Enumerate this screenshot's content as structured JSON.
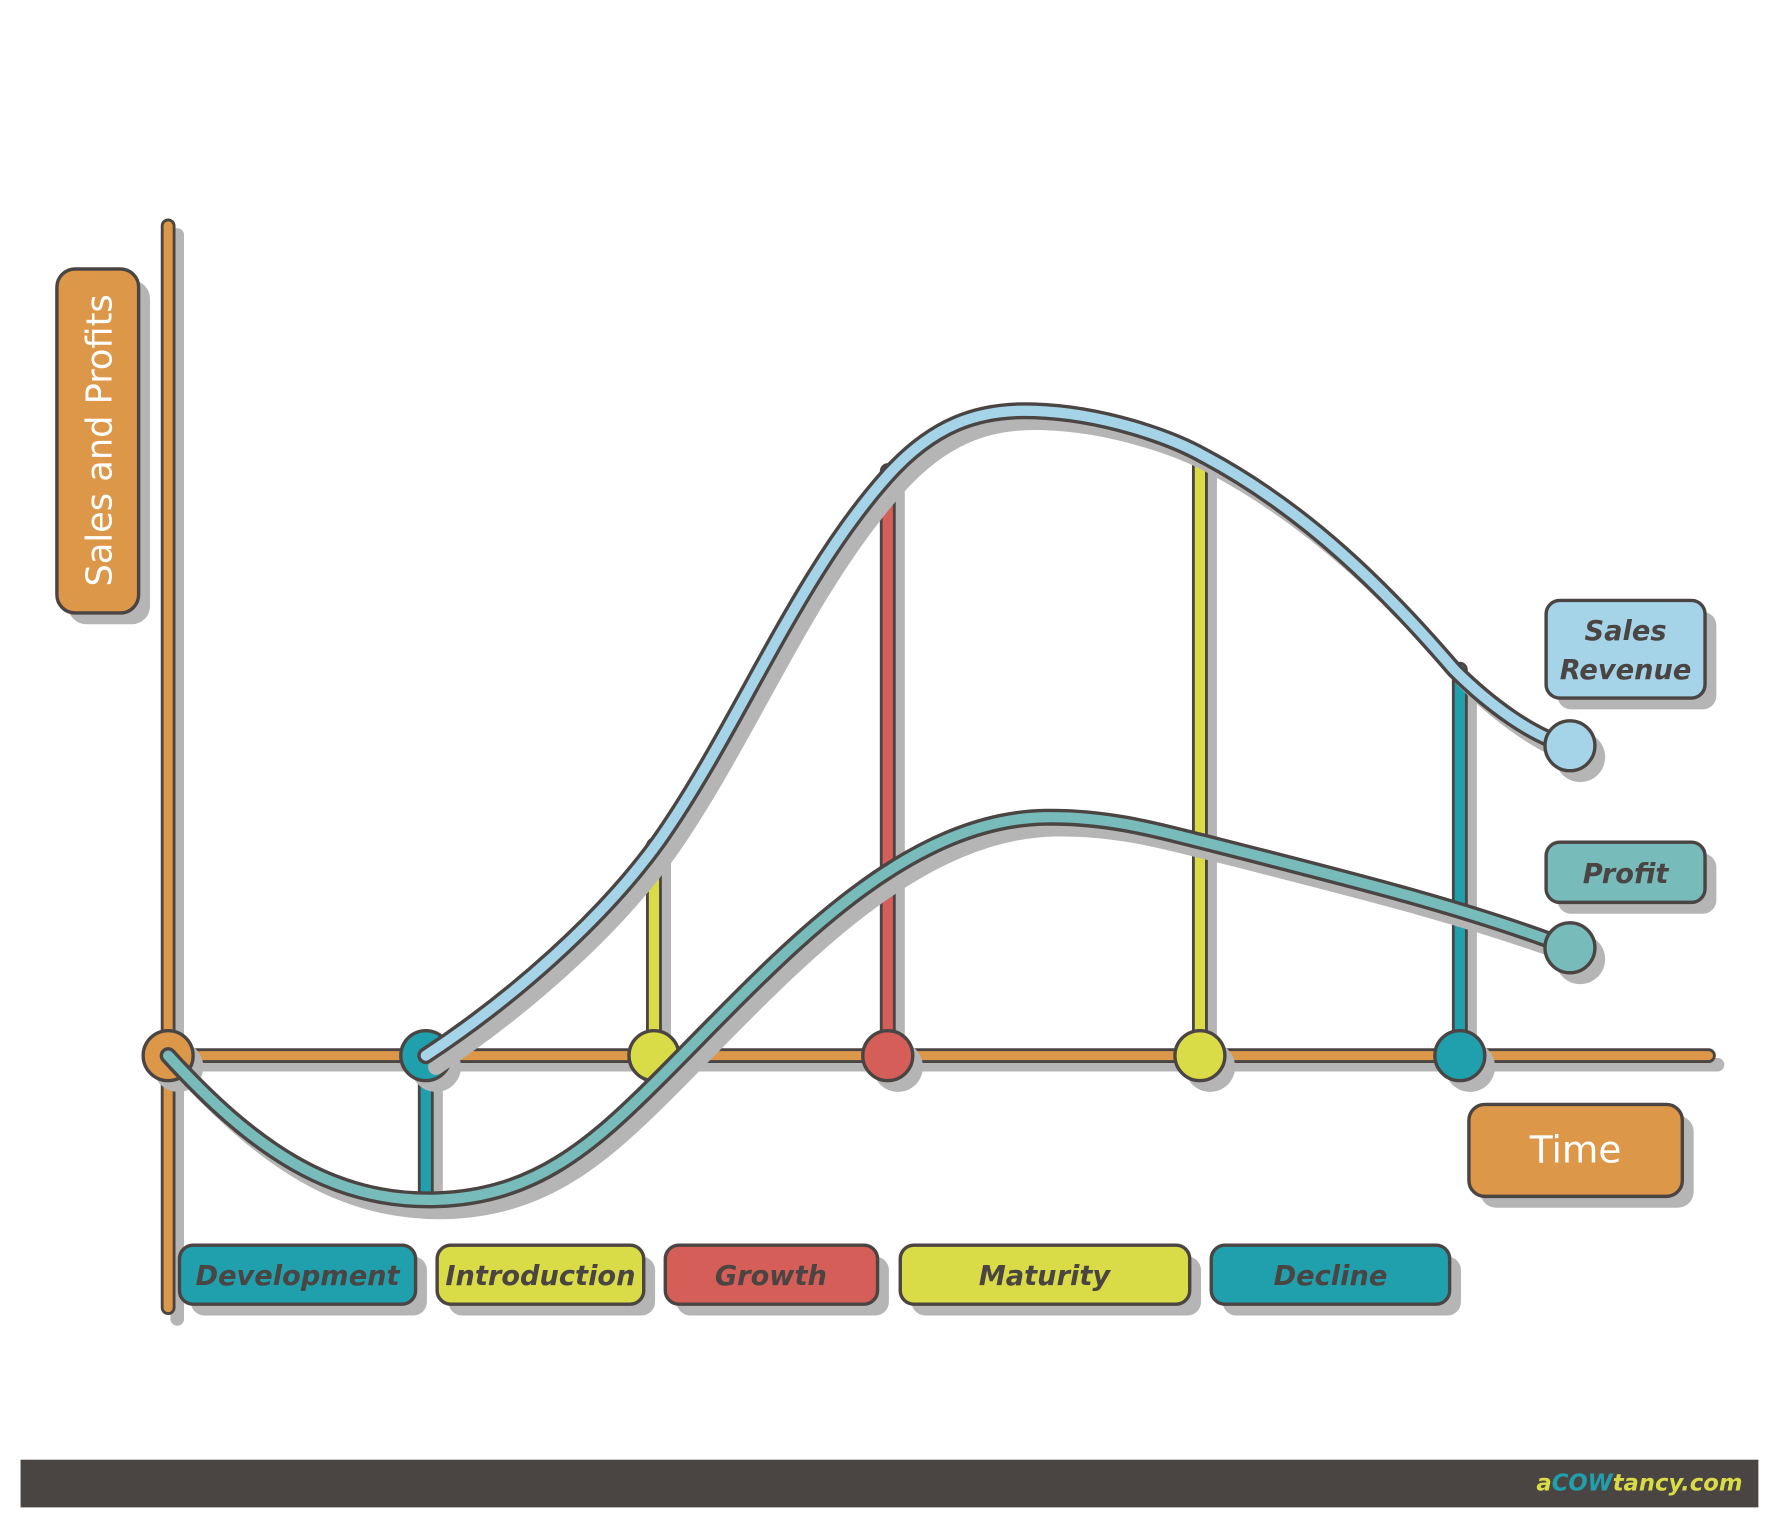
{
  "y_axis_label": "Sales and Profits",
  "x_axis_label": "Time",
  "legend": {
    "sales_line1": "Sales",
    "sales_line2": "Revenue",
    "profit": "Profit"
  },
  "phases": [
    {
      "label": "Development",
      "color": "#20A0AC"
    },
    {
      "label": "Introduction",
      "color": "#D9DB47"
    },
    {
      "label": "Growth",
      "color": "#D55E58"
    },
    {
      "label": "Maturity",
      "color": "#D9DB47"
    },
    {
      "label": "Decline",
      "color": "#20A0AC"
    }
  ],
  "footer": {
    "logo_a": "a",
    "logo_cow": "COW",
    "logo_rest": "tancy.com"
  },
  "colors": {
    "axis": "#DC9748",
    "sales": "#A5D3E7",
    "profit": "#78BBBB",
    "outline": "#4A4543",
    "footer": "#4A4542"
  }
}
